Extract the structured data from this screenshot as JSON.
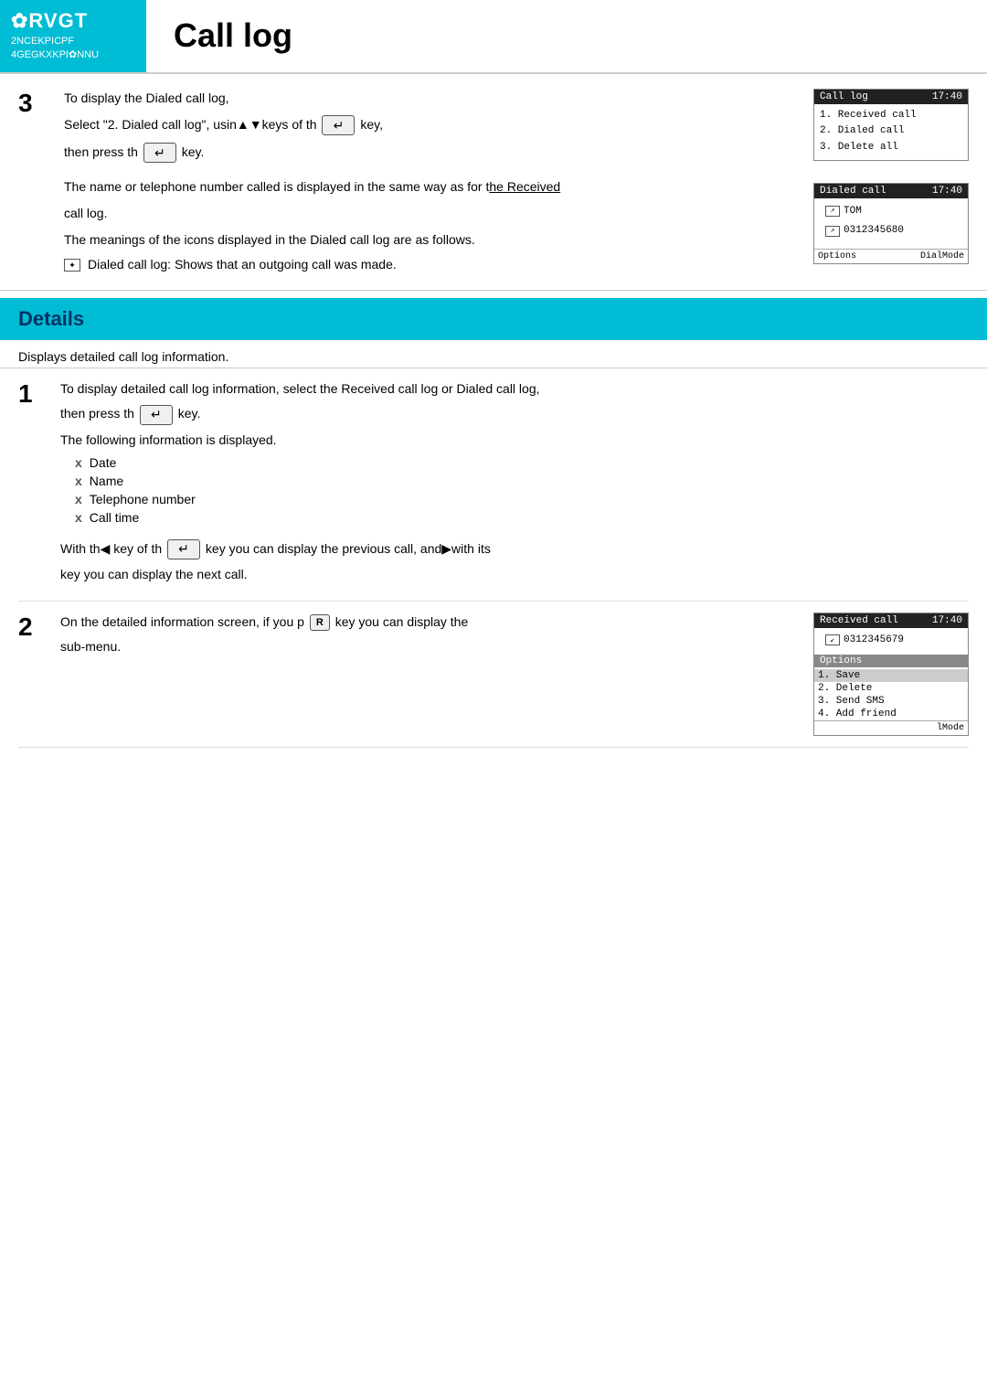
{
  "header": {
    "brand": "✿RVGT",
    "subtitle_line1": "2NCEKPICPF",
    "subtitle_line2": "4GEGKXKPI✿NNU",
    "title": "Call log"
  },
  "section3": {
    "number": "3",
    "step1": "To display the Dialed call log,",
    "step2_prefix": "Select \"2. Dialed call log\", usin▲▼keys of th",
    "step2_suffix": "key,",
    "step3": "then press th",
    "step3_suffix": " key.",
    "note1": "The name or telephone number called is displayed in the same way as for the Received call log.",
    "note2": "The meanings of the icons displayed in the Dialed call log are as follows.",
    "bullet1": "Dialed call log:  Shows that an outgoing call was made."
  },
  "phone1": {
    "header_left": "Call log",
    "header_right": "17:40",
    "items": [
      "1. Received call",
      "2. Dialed call",
      "3. Delete all"
    ]
  },
  "phone2": {
    "header_left": "Dialed call",
    "header_right": "17:40",
    "row1_name": "TOM",
    "row2_number": "0312345680",
    "footer_left": "Options",
    "footer_right": "DialMode"
  },
  "details": {
    "header": "Details",
    "intro": "Displays detailed call log information."
  },
  "detail_step1": {
    "number": "1",
    "text1": "To display detailed call log information, select the Received call log or Dialed call log,",
    "text2": "then press th",
    "text2_suffix": " key.",
    "text3": "The following information is displayed.",
    "items": [
      "Date",
      "Name",
      "Telephone number",
      "Call time"
    ],
    "text4_prefix": "With th◀ key of th",
    "text4_suffix": " key you can display the previous call, and▶with its",
    "text5": "key you can display the next call."
  },
  "detail_step2": {
    "number": "2",
    "text1_prefix": "On the detailed information screen, if you p",
    "text1_r": "R",
    "text1_suffix": "key you can display the",
    "text2": "sub-menu."
  },
  "phone3": {
    "header_left": "Received call",
    "header_right": "17:40",
    "number": "0312345679",
    "options_label": "Options",
    "menu_items": [
      "1. Save",
      "2. Delete",
      "3. Send SMS",
      "4. Add friend"
    ],
    "footer_right": "lMode"
  }
}
